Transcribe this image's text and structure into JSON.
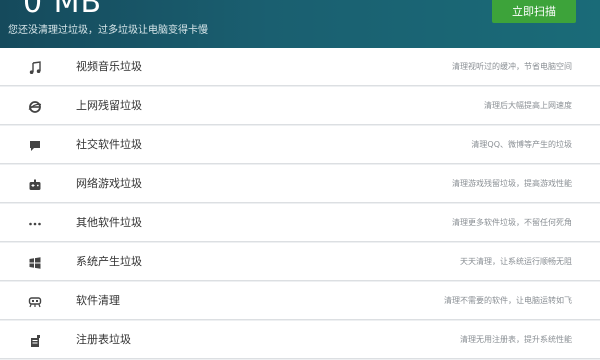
{
  "header": {
    "junk_size": "0 MB",
    "subtitle": "您还没清理过垃圾，过多垃圾让电脑变得卡慢",
    "scan_button": "立即扫描"
  },
  "categories": [
    {
      "label": "视频音乐垃圾",
      "desc": "清理视听过的缓冲，节省电脑空间",
      "icon": "music-note-icon"
    },
    {
      "label": "上网残留垃圾",
      "desc": "清理后大幅提高上网速度",
      "icon": "browser-icon"
    },
    {
      "label": "社交软件垃圾",
      "desc": "清理QQ、微博等产生的垃圾",
      "icon": "chat-bubble-icon"
    },
    {
      "label": "网络游戏垃圾",
      "desc": "清理游戏残留垃圾，提高游戏性能",
      "icon": "gamepad-icon"
    },
    {
      "label": "其他软件垃圾",
      "desc": "清理更多软件垃圾，不留任何死角",
      "icon": "more-dots-icon"
    },
    {
      "label": "系统产生垃圾",
      "desc": "天天清理，让系统运行顺畅无阻",
      "icon": "windows-icon"
    },
    {
      "label": "软件清理",
      "desc": "清理不需要的软件，让电脑运转如飞",
      "icon": "software-icon"
    },
    {
      "label": "注册表垃圾",
      "desc": "清理无用注册表，提升系统性能",
      "icon": "registry-icon"
    }
  ]
}
